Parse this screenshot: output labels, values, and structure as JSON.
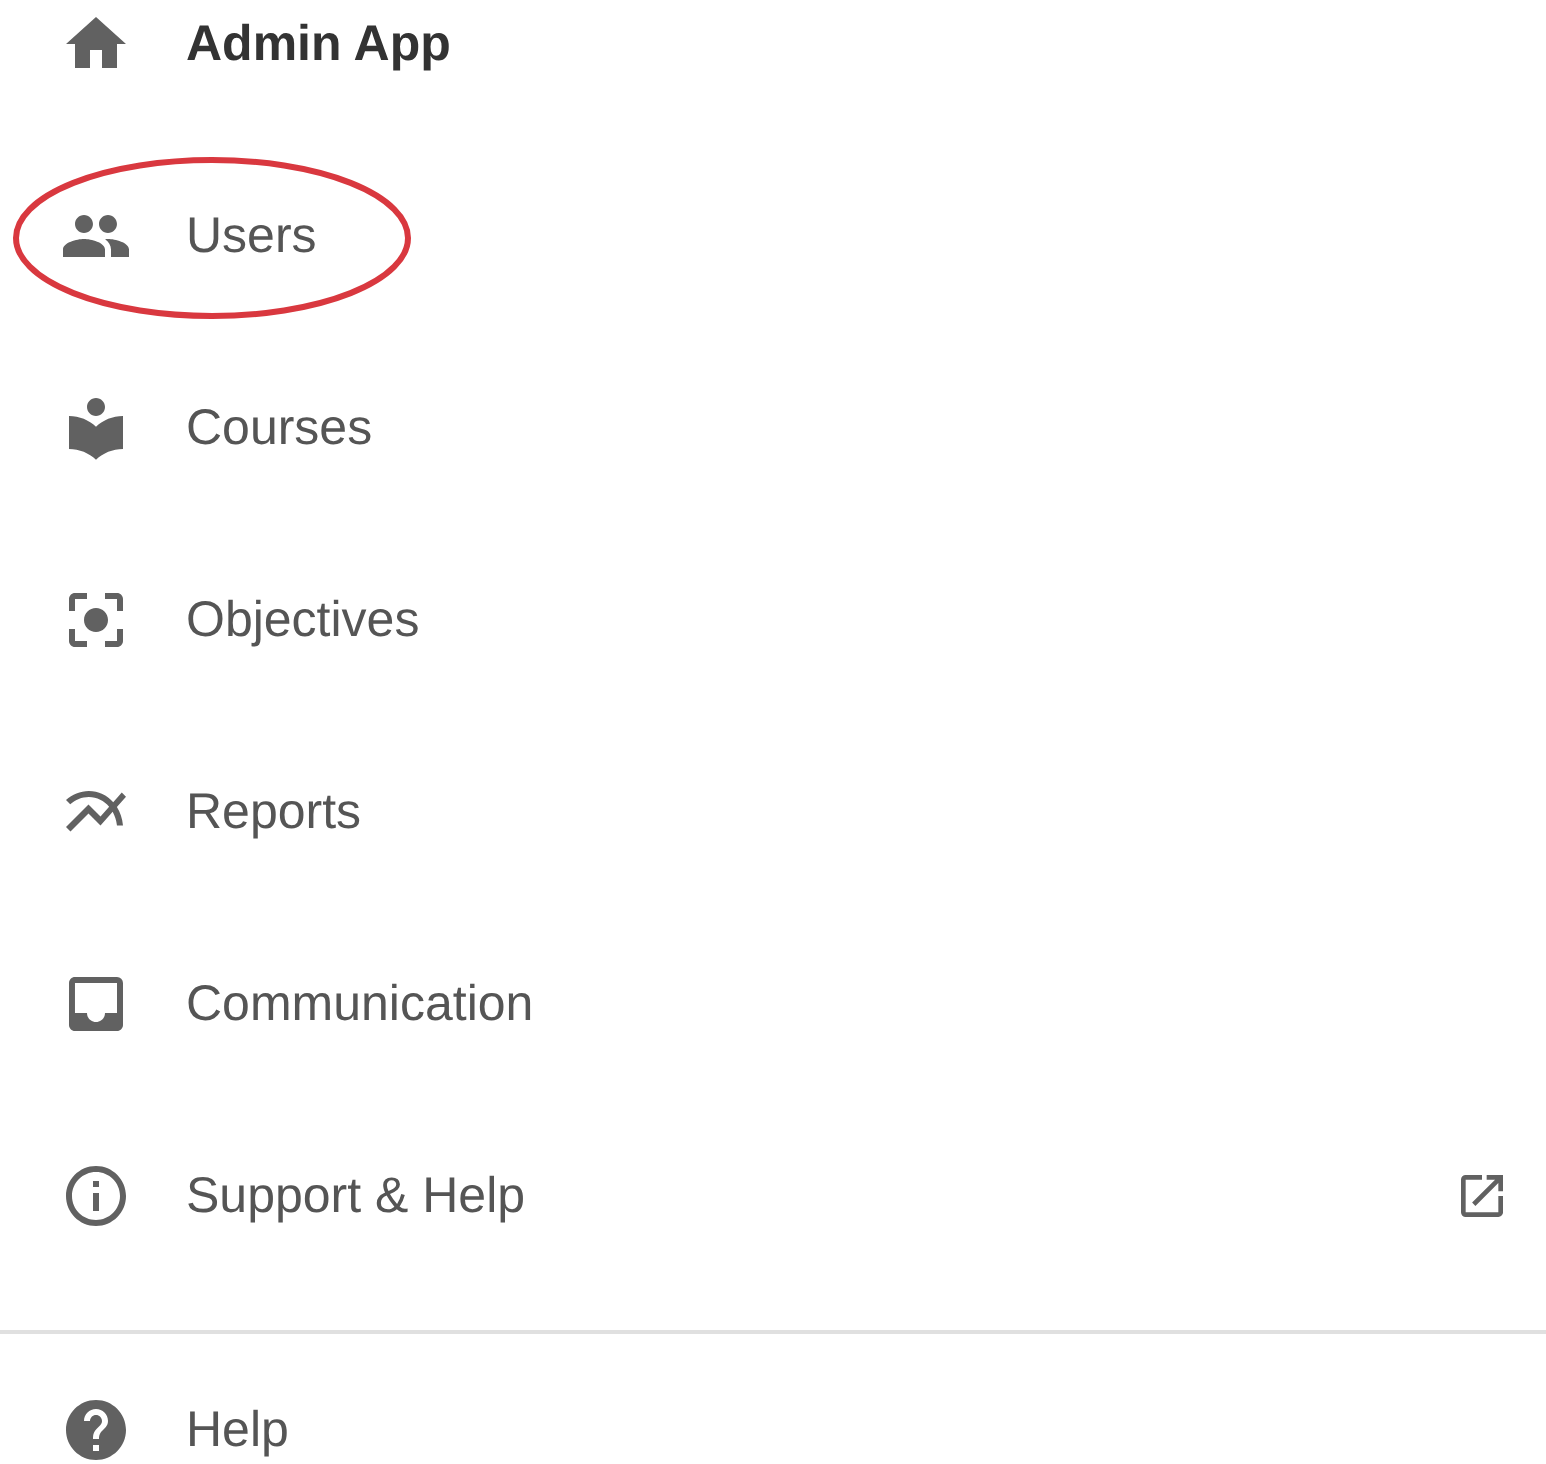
{
  "header": {
    "title": "Admin App"
  },
  "items": [
    {
      "label": "Users",
      "circled": true,
      "external": false
    },
    {
      "label": "Courses",
      "circled": false,
      "external": false
    },
    {
      "label": "Objectives",
      "circled": false,
      "external": false
    },
    {
      "label": "Reports",
      "circled": false,
      "external": false
    },
    {
      "label": "Communication",
      "circled": false,
      "external": false
    },
    {
      "label": "Support & Help",
      "circled": false,
      "external": true
    }
  ],
  "footer_items": [
    {
      "label": "Help"
    }
  ]
}
